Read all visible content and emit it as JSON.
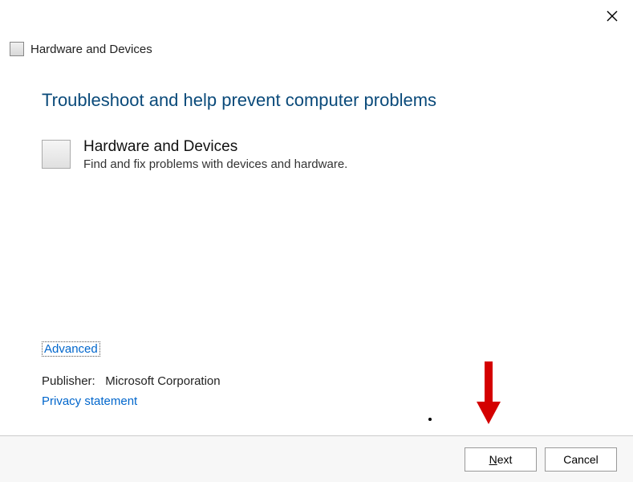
{
  "window": {
    "title": "Hardware and Devices"
  },
  "main": {
    "heading": "Troubleshoot and help prevent computer problems",
    "troubleshooter": {
      "name": "Hardware and Devices",
      "description": "Find and fix problems with devices and hardware."
    }
  },
  "links": {
    "advanced": "Advanced",
    "publisher_label": "Publisher:",
    "publisher_value": "Microsoft Corporation",
    "privacy": "Privacy statement"
  },
  "buttons": {
    "next": "Next",
    "cancel": "Cancel"
  }
}
